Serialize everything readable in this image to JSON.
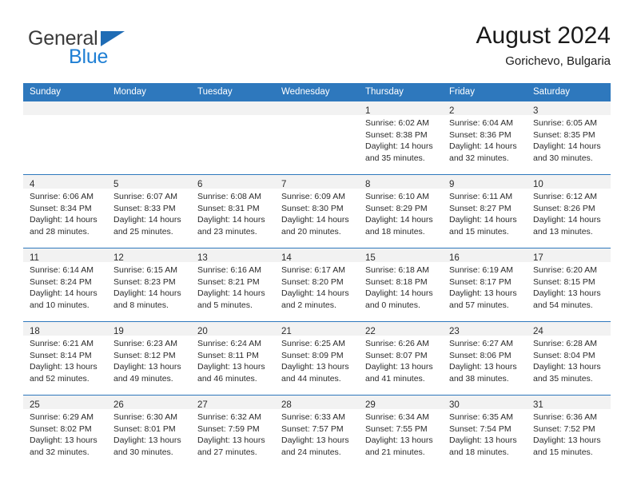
{
  "brand": {
    "word_one": "General",
    "word_two": "Blue",
    "triangle_icon": "triangle-icon",
    "color_dark": "#3b3b3b",
    "color_blue": "#1f7fd4"
  },
  "header": {
    "title": "August 2024",
    "subtitle": "Gorichevo, Bulgaria"
  },
  "colors": {
    "header_blue": "#2e78bd",
    "daynum_bg": "#f2f2f2",
    "text": "#2b2b2b"
  },
  "weekdays": [
    "Sunday",
    "Monday",
    "Tuesday",
    "Wednesday",
    "Thursday",
    "Friday",
    "Saturday"
  ],
  "weeks": [
    [
      {
        "day": "",
        "lines": []
      },
      {
        "day": "",
        "lines": []
      },
      {
        "day": "",
        "lines": []
      },
      {
        "day": "",
        "lines": []
      },
      {
        "day": "1",
        "lines": [
          "Sunrise: 6:02 AM",
          "Sunset: 8:38 PM",
          "Daylight: 14 hours",
          "and 35 minutes."
        ]
      },
      {
        "day": "2",
        "lines": [
          "Sunrise: 6:04 AM",
          "Sunset: 8:36 PM",
          "Daylight: 14 hours",
          "and 32 minutes."
        ]
      },
      {
        "day": "3",
        "lines": [
          "Sunrise: 6:05 AM",
          "Sunset: 8:35 PM",
          "Daylight: 14 hours",
          "and 30 minutes."
        ]
      }
    ],
    [
      {
        "day": "4",
        "lines": [
          "Sunrise: 6:06 AM",
          "Sunset: 8:34 PM",
          "Daylight: 14 hours",
          "and 28 minutes."
        ]
      },
      {
        "day": "5",
        "lines": [
          "Sunrise: 6:07 AM",
          "Sunset: 8:33 PM",
          "Daylight: 14 hours",
          "and 25 minutes."
        ]
      },
      {
        "day": "6",
        "lines": [
          "Sunrise: 6:08 AM",
          "Sunset: 8:31 PM",
          "Daylight: 14 hours",
          "and 23 minutes."
        ]
      },
      {
        "day": "7",
        "lines": [
          "Sunrise: 6:09 AM",
          "Sunset: 8:30 PM",
          "Daylight: 14 hours",
          "and 20 minutes."
        ]
      },
      {
        "day": "8",
        "lines": [
          "Sunrise: 6:10 AM",
          "Sunset: 8:29 PM",
          "Daylight: 14 hours",
          "and 18 minutes."
        ]
      },
      {
        "day": "9",
        "lines": [
          "Sunrise: 6:11 AM",
          "Sunset: 8:27 PM",
          "Daylight: 14 hours",
          "and 15 minutes."
        ]
      },
      {
        "day": "10",
        "lines": [
          "Sunrise: 6:12 AM",
          "Sunset: 8:26 PM",
          "Daylight: 14 hours",
          "and 13 minutes."
        ]
      }
    ],
    [
      {
        "day": "11",
        "lines": [
          "Sunrise: 6:14 AM",
          "Sunset: 8:24 PM",
          "Daylight: 14 hours",
          "and 10 minutes."
        ]
      },
      {
        "day": "12",
        "lines": [
          "Sunrise: 6:15 AM",
          "Sunset: 8:23 PM",
          "Daylight: 14 hours",
          "and 8 minutes."
        ]
      },
      {
        "day": "13",
        "lines": [
          "Sunrise: 6:16 AM",
          "Sunset: 8:21 PM",
          "Daylight: 14 hours",
          "and 5 minutes."
        ]
      },
      {
        "day": "14",
        "lines": [
          "Sunrise: 6:17 AM",
          "Sunset: 8:20 PM",
          "Daylight: 14 hours",
          "and 2 minutes."
        ]
      },
      {
        "day": "15",
        "lines": [
          "Sunrise: 6:18 AM",
          "Sunset: 8:18 PM",
          "Daylight: 14 hours",
          "and 0 minutes."
        ]
      },
      {
        "day": "16",
        "lines": [
          "Sunrise: 6:19 AM",
          "Sunset: 8:17 PM",
          "Daylight: 13 hours",
          "and 57 minutes."
        ]
      },
      {
        "day": "17",
        "lines": [
          "Sunrise: 6:20 AM",
          "Sunset: 8:15 PM",
          "Daylight: 13 hours",
          "and 54 minutes."
        ]
      }
    ],
    [
      {
        "day": "18",
        "lines": [
          "Sunrise: 6:21 AM",
          "Sunset: 8:14 PM",
          "Daylight: 13 hours",
          "and 52 minutes."
        ]
      },
      {
        "day": "19",
        "lines": [
          "Sunrise: 6:23 AM",
          "Sunset: 8:12 PM",
          "Daylight: 13 hours",
          "and 49 minutes."
        ]
      },
      {
        "day": "20",
        "lines": [
          "Sunrise: 6:24 AM",
          "Sunset: 8:11 PM",
          "Daylight: 13 hours",
          "and 46 minutes."
        ]
      },
      {
        "day": "21",
        "lines": [
          "Sunrise: 6:25 AM",
          "Sunset: 8:09 PM",
          "Daylight: 13 hours",
          "and 44 minutes."
        ]
      },
      {
        "day": "22",
        "lines": [
          "Sunrise: 6:26 AM",
          "Sunset: 8:07 PM",
          "Daylight: 13 hours",
          "and 41 minutes."
        ]
      },
      {
        "day": "23",
        "lines": [
          "Sunrise: 6:27 AM",
          "Sunset: 8:06 PM",
          "Daylight: 13 hours",
          "and 38 minutes."
        ]
      },
      {
        "day": "24",
        "lines": [
          "Sunrise: 6:28 AM",
          "Sunset: 8:04 PM",
          "Daylight: 13 hours",
          "and 35 minutes."
        ]
      }
    ],
    [
      {
        "day": "25",
        "lines": [
          "Sunrise: 6:29 AM",
          "Sunset: 8:02 PM",
          "Daylight: 13 hours",
          "and 32 minutes."
        ]
      },
      {
        "day": "26",
        "lines": [
          "Sunrise: 6:30 AM",
          "Sunset: 8:01 PM",
          "Daylight: 13 hours",
          "and 30 minutes."
        ]
      },
      {
        "day": "27",
        "lines": [
          "Sunrise: 6:32 AM",
          "Sunset: 7:59 PM",
          "Daylight: 13 hours",
          "and 27 minutes."
        ]
      },
      {
        "day": "28",
        "lines": [
          "Sunrise: 6:33 AM",
          "Sunset: 7:57 PM",
          "Daylight: 13 hours",
          "and 24 minutes."
        ]
      },
      {
        "day": "29",
        "lines": [
          "Sunrise: 6:34 AM",
          "Sunset: 7:55 PM",
          "Daylight: 13 hours",
          "and 21 minutes."
        ]
      },
      {
        "day": "30",
        "lines": [
          "Sunrise: 6:35 AM",
          "Sunset: 7:54 PM",
          "Daylight: 13 hours",
          "and 18 minutes."
        ]
      },
      {
        "day": "31",
        "lines": [
          "Sunrise: 6:36 AM",
          "Sunset: 7:52 PM",
          "Daylight: 13 hours",
          "and 15 minutes."
        ]
      }
    ]
  ]
}
